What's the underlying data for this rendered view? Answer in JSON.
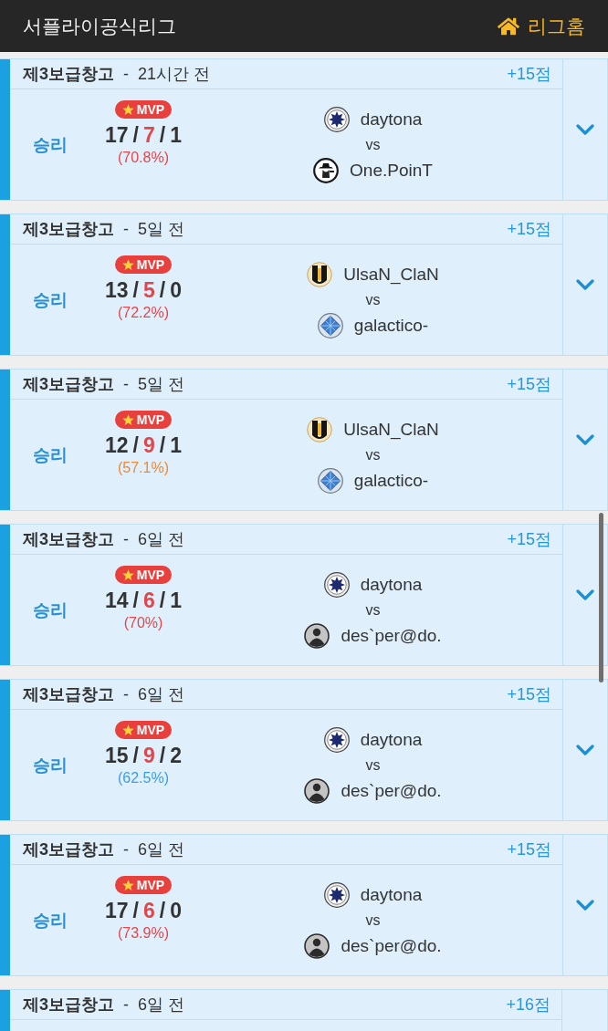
{
  "header": {
    "title": "서플라이공식리그",
    "home_link": "리그홈"
  },
  "matches": [
    {
      "title": "**제3보급창고**  -  21시간 전",
      "points": "+15점",
      "result": "승리",
      "badge": "MVP",
      "kda": [
        {
          "text": "17",
          "kind": "kills"
        },
        {
          "text": "/",
          "kind": "separator"
        },
        {
          "text": "7",
          "kind": "deaths"
        },
        {
          "text": "/",
          "kind": "separator"
        },
        {
          "text": "1",
          "kind": "assists"
        }
      ],
      "kill_rate": {
        "text": "(70.8%)",
        "color": "#e0474c"
      },
      "teams": [
        {
          "name": "daytona",
          "kind": "star-emblem"
        },
        {
          "name": "One.PoinT",
          "kind": "hat-emblem"
        }
      ],
      "vs": "vs",
      "expanded": false
    },
    {
      "title": "**제3보급창고**  -  5일 전",
      "points": "+15점",
      "result": "승리",
      "badge": "MVP",
      "kda": [
        {
          "text": "13",
          "kind": "kills"
        },
        {
          "text": "/",
          "kind": "separator"
        },
        {
          "text": "5",
          "kind": "deaths"
        },
        {
          "text": "/",
          "kind": "separator"
        },
        {
          "text": "0",
          "kind": "assists"
        }
      ],
      "kill_rate": {
        "text": "(72.2%)",
        "color": "#e0474c"
      },
      "teams": [
        {
          "name": "UlsaN_ClaN",
          "kind": "letter-emblem"
        },
        {
          "name": "galactico-",
          "kind": "diamond-emblem"
        }
      ],
      "vs": "vs",
      "expanded": false
    },
    {
      "title": "**제3보급창고**  -  5일 전",
      "points": "+15점",
      "result": "승리",
      "badge": "MVP",
      "kda": [
        {
          "text": "12",
          "kind": "kills"
        },
        {
          "text": "/",
          "kind": "separator"
        },
        {
          "text": "9",
          "kind": "deaths"
        },
        {
          "text": "/",
          "kind": "separator"
        },
        {
          "text": "1",
          "kind": "assists"
        }
      ],
      "kill_rate": {
        "text": "(57.1%)",
        "color": "#e8893c"
      },
      "teams": [
        {
          "name": "UlsaN_ClaN",
          "kind": "letter-emblem"
        },
        {
          "name": "galactico-",
          "kind": "diamond-emblem"
        }
      ],
      "vs": "vs",
      "expanded": false
    },
    {
      "title": "**제3보급창고**  -  6일 전",
      "points": "+15점",
      "result": "승리",
      "badge": "MVP",
      "kda": [
        {
          "text": "14",
          "kind": "kills"
        },
        {
          "text": "/",
          "kind": "separator"
        },
        {
          "text": "6",
          "kind": "deaths"
        },
        {
          "text": "/",
          "kind": "separator"
        },
        {
          "text": "1",
          "kind": "assists"
        }
      ],
      "kill_rate": {
        "text": "(70%)",
        "color": "#e0474c"
      },
      "teams": [
        {
          "name": "daytona",
          "kind": "star-emblem"
        },
        {
          "name": "des`per@do.",
          "kind": "avatar"
        }
      ],
      "vs": "vs",
      "expanded": false
    },
    {
      "title": "**제3보급창고**  -  6일 전",
      "points": "+15점",
      "result": "승리",
      "badge": "MVP",
      "kda": [
        {
          "text": "15",
          "kind": "kills"
        },
        {
          "text": "/",
          "kind": "separator"
        },
        {
          "text": "9",
          "kind": "deaths"
        },
        {
          "text": "/",
          "kind": "separator"
        },
        {
          "text": "2",
          "kind": "assists"
        }
      ],
      "kill_rate": {
        "text": "(62.5%)",
        "color": "#3b9de0"
      },
      "teams": [
        {
          "name": "daytona",
          "kind": "star-emblem"
        },
        {
          "name": "des`per@do.",
          "kind": "avatar"
        }
      ],
      "vs": "vs",
      "expanded": false
    },
    {
      "title": "**제3보급창고**  -  6일 전",
      "points": "+15점",
      "result": "승리",
      "badge": "MVP",
      "kda": [
        {
          "text": "17",
          "kind": "kills"
        },
        {
          "text": "/",
          "kind": "separator"
        },
        {
          "text": "6",
          "kind": "deaths"
        },
        {
          "text": "/",
          "kind": "separator"
        },
        {
          "text": "0",
          "kind": "assists"
        }
      ],
      "kill_rate": {
        "text": "(73.9%)",
        "color": "#e0474c"
      },
      "teams": [
        {
          "name": "daytona",
          "kind": "star-emblem"
        },
        {
          "name": "des`per@do.",
          "kind": "avatar"
        }
      ],
      "vs": "vs",
      "expanded": false
    },
    {
      "title": "**제3보급창고**  -  6일 전",
      "points": "+16점"
    }
  ]
}
